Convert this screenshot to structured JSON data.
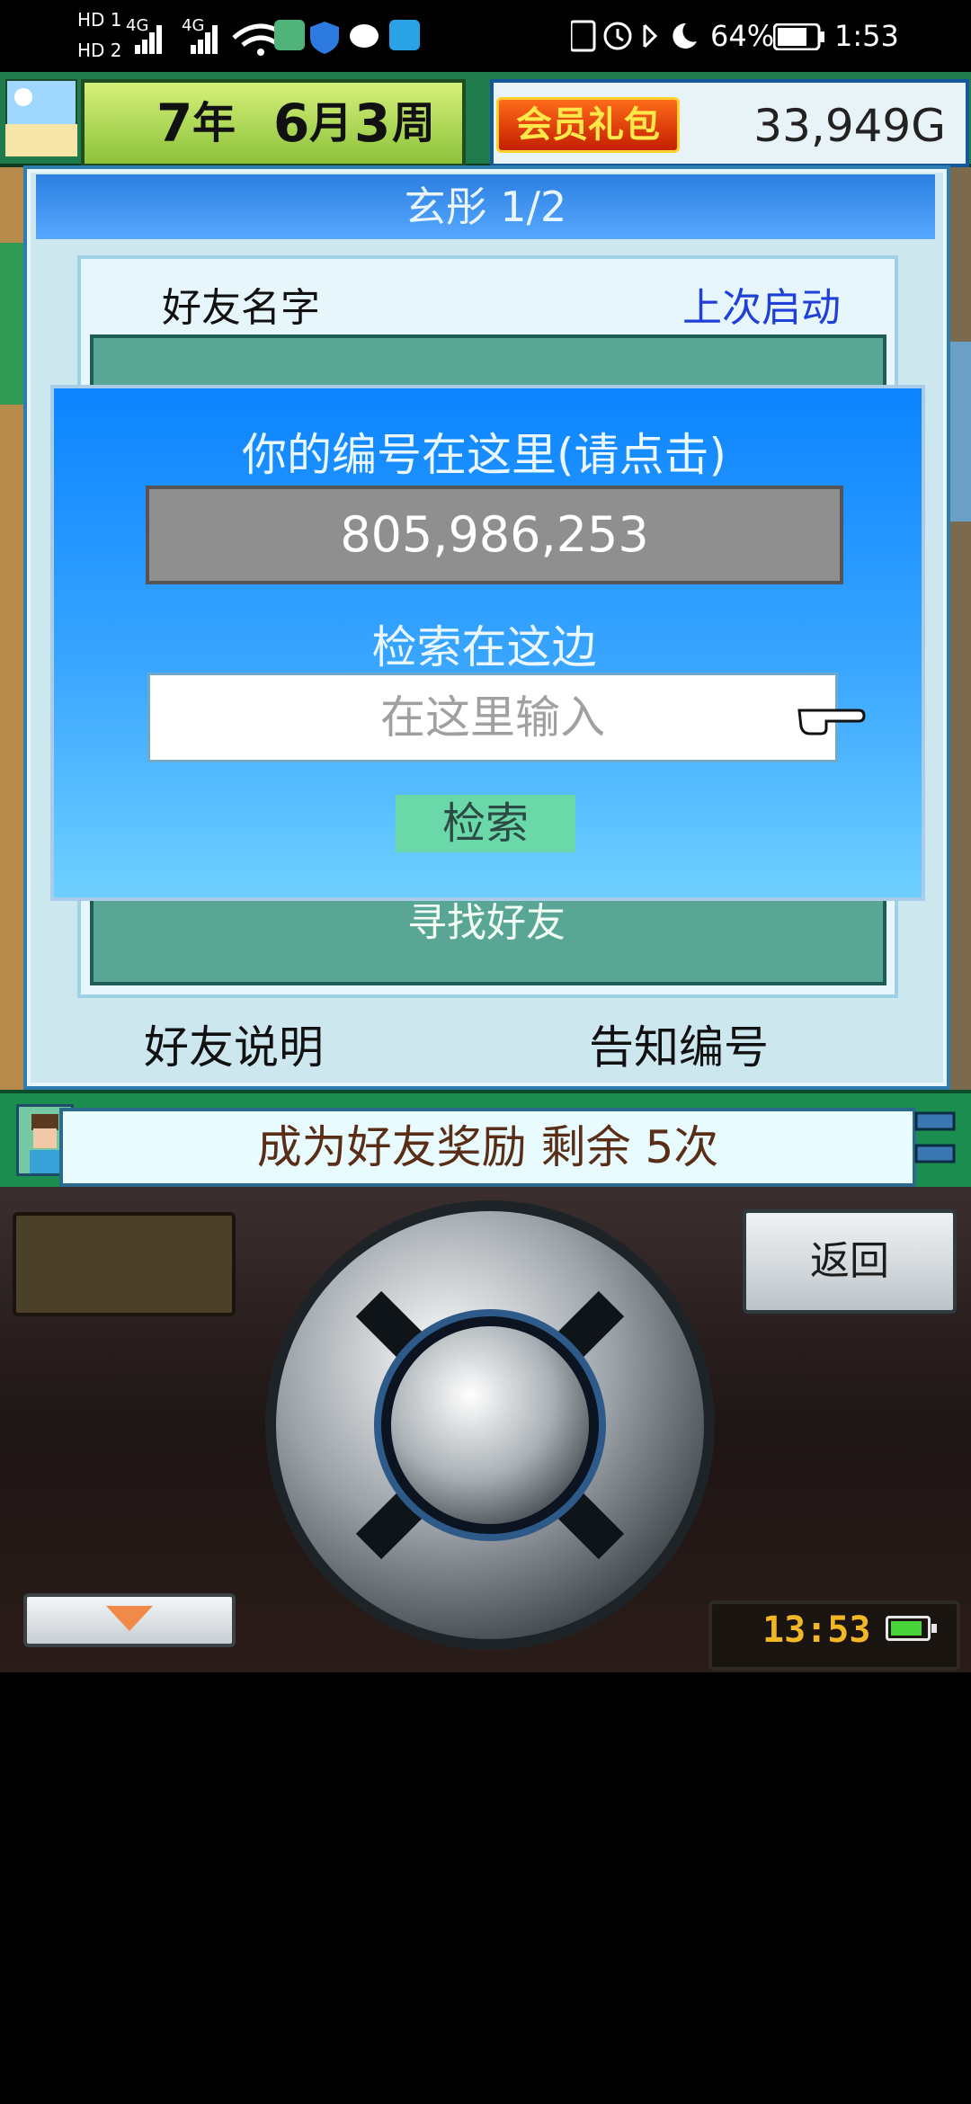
{
  "status_bar": {
    "hd_labels": [
      "HD 1",
      "HD 2"
    ],
    "signal_labels": [
      "4G",
      "4G"
    ],
    "battery_percent": "64%",
    "time": "1:53"
  },
  "top_bar": {
    "year_num": "7",
    "year_unit": "年",
    "month_num": "6",
    "month_unit": "月",
    "week_num": "3",
    "week_unit": "周",
    "vip_label": "会员礼包",
    "money": "33,949G"
  },
  "dialog": {
    "title": "玄彤 1/2",
    "list_header_left": "好友名字",
    "list_header_right": "上次启动",
    "find_friend": "寻找好友",
    "bottom_left": "好友说明",
    "bottom_right": "告知编号"
  },
  "search_modal": {
    "title": "你的编号在这里(请点击)",
    "id_value": "805,986,253",
    "search_label": "检索在这边",
    "input_placeholder": "在这里输入",
    "search_button": "检索"
  },
  "info_bar": {
    "reward_text": "成为好友奖励 剩余 5次"
  },
  "controller": {
    "back_button": "返回",
    "clock": "13:53"
  },
  "colors": {
    "modal_blue": "#0b84ff",
    "teal_list": "#5aa695",
    "vip_orange": "#ff6b1a",
    "link_blue": "#1f3fd6"
  }
}
